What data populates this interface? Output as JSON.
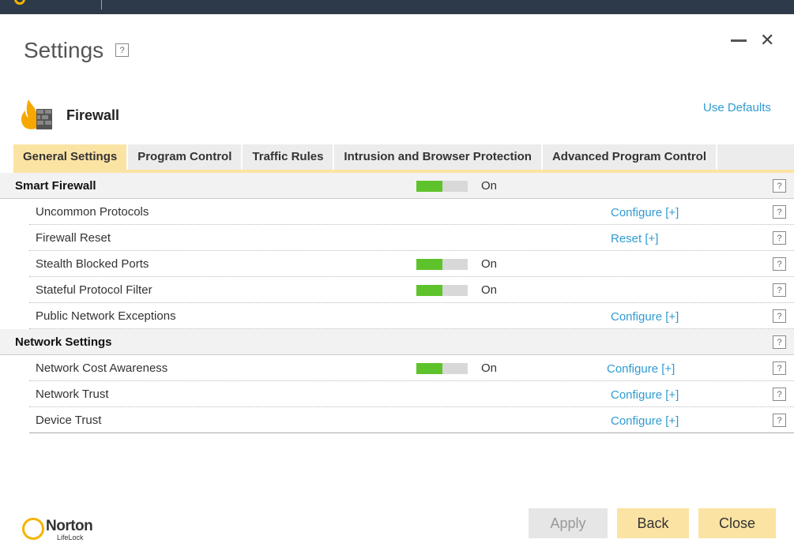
{
  "window": {
    "title": "Settings",
    "help": "?"
  },
  "feature": {
    "title": "Firewall",
    "use_defaults": "Use Defaults"
  },
  "tabs": [
    {
      "label": "General Settings"
    },
    {
      "label": "Program Control"
    },
    {
      "label": "Traffic Rules"
    },
    {
      "label": "Intrusion and Browser Protection"
    },
    {
      "label": "Advanced Program Control"
    }
  ],
  "sections": {
    "smart_firewall": {
      "label": "Smart Firewall",
      "state": "On",
      "items": {
        "uncommon_protocols": {
          "label": "Uncommon Protocols",
          "action": "Configure [+]"
        },
        "firewall_reset": {
          "label": "Firewall Reset",
          "action": "Reset [+]"
        },
        "stealth_blocked_ports": {
          "label": "Stealth Blocked Ports",
          "state": "On"
        },
        "stateful_protocol_filter": {
          "label": "Stateful Protocol Filter",
          "state": "On"
        },
        "public_network_exceptions": {
          "label": "Public Network Exceptions",
          "action": "Configure [+]"
        }
      }
    },
    "network_settings": {
      "label": "Network Settings",
      "items": {
        "network_cost_awareness": {
          "label": "Network Cost Awareness",
          "state": "On",
          "action": "Configure [+]"
        },
        "network_trust": {
          "label": "Network Trust",
          "action": "Configure [+]"
        },
        "device_trust": {
          "label": "Device Trust",
          "action": "Configure [+]"
        }
      }
    }
  },
  "toggle_level_on": 0.5,
  "footer": {
    "brand": "Norton",
    "brand_sub": "LifeLock",
    "apply": "Apply",
    "back": "Back",
    "close": "Close"
  },
  "colors": {
    "accent": "#fbe3a3",
    "link": "#2f9bd1",
    "toggle_on": "#5ec32a",
    "titlebar": "#2d3a4a"
  }
}
